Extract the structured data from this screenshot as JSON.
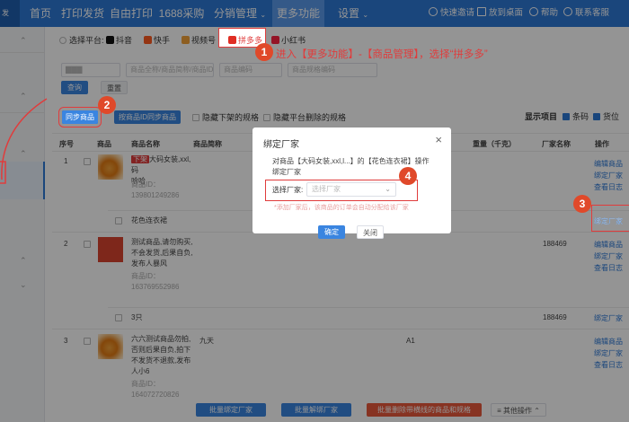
{
  "topnav": {
    "logo": "发",
    "items": [
      "首页",
      "打印发货",
      "自由打印",
      "1688采购",
      "分销管理",
      "更多功能",
      "设置"
    ],
    "right": [
      "快速邀请",
      "放到桌面",
      "帮助",
      "联系客服"
    ]
  },
  "platforms": {
    "label": "选择平台:",
    "items": [
      "抖音",
      "快手",
      "视频号",
      "拼多多",
      "小红书"
    ]
  },
  "annotations": {
    "step1": "进入【更多功能】-【商品管理】，选择“拼多多”",
    "badge1": "1",
    "badge2": "2",
    "badge3": "3",
    "badge4": "4"
  },
  "filters": {
    "placeholders": [
      "商品全称/商品简称/商品ID",
      "商品编码",
      "商品规格编码"
    ],
    "search_label": "查询",
    "reset_label": "重置"
  },
  "toolbar": {
    "sync_label": "同步商品",
    "sync_by_id_label": "按商品ID同步商品",
    "hide_offshelf_label": "隐藏下架的规格",
    "hide_deleted_label": "隐藏平台删除的规格",
    "display_label": "显示项目",
    "display_options": [
      "条码",
      "货位"
    ]
  },
  "table": {
    "headers": [
      "序号",
      "商品",
      "商品名称",
      "商品简称",
      "重量（千克）",
      "厂家名称",
      "操作"
    ],
    "rows": [
      {
        "no": "1",
        "tag": "下架",
        "name": "大码女装,xxl,码",
        "name2": "哈哈",
        "id": "商品ID：139801249286",
        "sku": "花色连衣裙",
        "factory": "",
        "ops": [
          "编辑商品",
          "绑定厂家",
          "查看日志"
        ]
      },
      {
        "no": "2",
        "name": "测试商品,请勿购买,不会发货,后果自负,发布人暴风",
        "id": "商品ID：163769552986",
        "sku": "3只",
        "factory": "188469",
        "ops": [
          "编辑商品",
          "绑定厂家",
          "查看日志"
        ]
      },
      {
        "no": "3",
        "name": "六六测试商品勿拍,否则后果自负,拍下不发货不退款,发布人小6",
        "id": "商品ID：164072720826",
        "short": "九天",
        "code": "A1",
        "ops": [
          "编辑商品",
          "绑定厂家",
          "查看日志"
        ]
      }
    ],
    "sku_op": "绑定厂家",
    "row2_factory2": "188469"
  },
  "modal": {
    "title": "绑定厂家",
    "message": "对商品【大码女装,xxl,l...】的【花色连衣裙】操作绑定厂家",
    "field_label": "选择厂家:",
    "field_placeholder": "选择厂家",
    "hint": "*添加厂家后，该商品的订单会自动分配给该厂家",
    "confirm_label": "确定",
    "cancel_label": "关闭"
  },
  "footer": {
    "buttons": [
      "批量绑定厂家",
      "批量解绑厂家",
      "批量删除带横线的商品和规格",
      "其他操作"
    ]
  },
  "colors": {
    "primary": "#2e79d6",
    "annotation": "#e03c3c",
    "badge": "#e0492a"
  }
}
